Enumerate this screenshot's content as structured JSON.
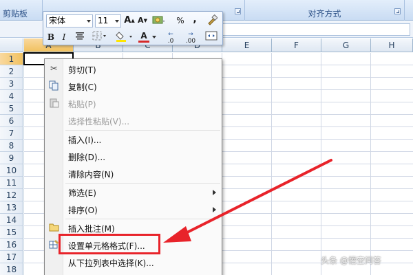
{
  "ribbon": {
    "groups": [
      {
        "label": "剪贴板"
      },
      {
        "label": ""
      },
      {
        "label": "对齐方式"
      }
    ]
  },
  "grid": {
    "columns": [
      "A",
      "B",
      "C",
      "D",
      "E",
      "F",
      "G",
      "H"
    ],
    "rows": [
      "1",
      "2",
      "3",
      "4",
      "5",
      "6",
      "7",
      "8",
      "9",
      "10",
      "11",
      "12",
      "13",
      "14",
      "15",
      "16",
      "17",
      "18"
    ],
    "selected_cell": "A1"
  },
  "mini_toolbar": {
    "font_name": "宋体",
    "font_size": "11",
    "grow_font": "A",
    "shrink_font": "A",
    "percent": "%",
    "comma": ",",
    "bold": "B",
    "italic": "I",
    "font_color_glyph": "A",
    "increase_decimal": ".0",
    "decrease_decimal": ".00",
    "colors": {
      "font_color": "#d62828",
      "fill_color": "#ffe600"
    }
  },
  "context_menu": {
    "items": [
      {
        "label": "剪切(T)",
        "icon": "scissors-icon"
      },
      {
        "label": "复制(C)",
        "icon": "copy-icon"
      },
      {
        "label": "粘贴(P)",
        "icon": "paste-icon",
        "disabled": true
      },
      {
        "label": "选择性粘贴(V)...",
        "disabled": true
      },
      {
        "label": "插入(I)..."
      },
      {
        "label": "删除(D)..."
      },
      {
        "label": "清除内容(N)"
      },
      {
        "label": "筛选(E)",
        "submenu": true
      },
      {
        "label": "排序(O)",
        "submenu": true
      },
      {
        "label": "插入批注(M)",
        "icon": "comment-icon"
      },
      {
        "label": "设置单元格格式(F)...",
        "icon": "format-cells-icon",
        "highlighted": true
      },
      {
        "label": "从下拉列表中选择(K)..."
      }
    ]
  },
  "annotation": {
    "color": "#e8232a"
  },
  "watermark": {
    "text": "头条 @悟空问答"
  }
}
